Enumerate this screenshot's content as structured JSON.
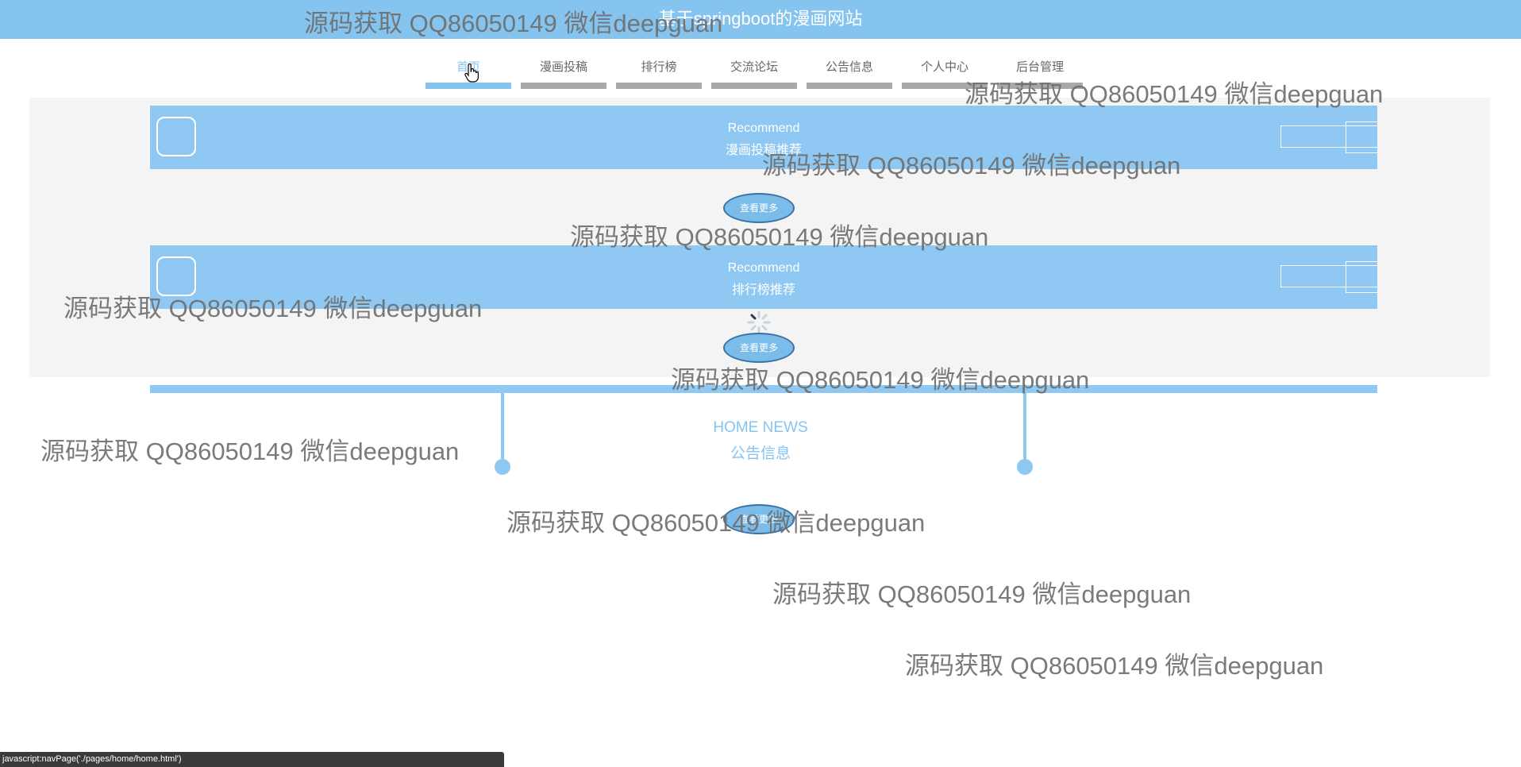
{
  "header": {
    "title": "基于springboot的漫画网站"
  },
  "nav": {
    "items": [
      {
        "label": "首页",
        "active": true
      },
      {
        "label": "漫画投稿",
        "active": false
      },
      {
        "label": "排行榜",
        "active": false
      },
      {
        "label": "交流论坛",
        "active": false
      },
      {
        "label": "公告信息",
        "active": false
      },
      {
        "label": "个人中心",
        "active": false
      },
      {
        "label": "后台管理",
        "active": false
      }
    ]
  },
  "sections": {
    "manga_recommend": {
      "en": "Recommend",
      "cn": "漫画投稿推荐",
      "more": "查看更多"
    },
    "rank_recommend": {
      "en": "Recommend",
      "cn": "排行榜推荐",
      "more": "查看更多"
    },
    "news": {
      "en": "HOME NEWS",
      "cn": "公告信息",
      "more": "查看更多"
    }
  },
  "watermark": {
    "text": "源码获取 QQ86050149 微信deepguan"
  },
  "statusbar": {
    "text": "javascript:navPage('./pages/home/home.html')"
  },
  "colors": {
    "accent": "#86c4f0",
    "panel": "#f4f4f4",
    "nav_inactive": "#a9a9a9"
  },
  "icons": {
    "cursor": "hand-pointer-icon",
    "loading": "loading-spinner-icon"
  }
}
